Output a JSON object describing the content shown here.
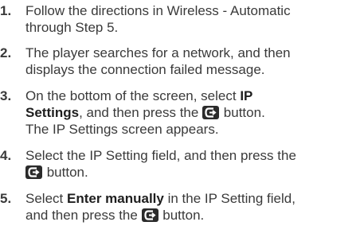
{
  "steps": [
    {
      "number": "1.",
      "lines": [
        "Follow the directions in Wireless - Automatic",
        "through Step 5."
      ]
    },
    {
      "number": "2.",
      "lines": [
        "The player searches for a network, and then",
        "displays the connection failed message."
      ]
    },
    {
      "number": "3.",
      "line1_pre": "On the bottom of the screen, select ",
      "line1_bold": "IP",
      "line2_bold": "Settings",
      "line2_post": ", and then press the",
      "line2_end": " button.",
      "line3": "The IP Settings screen appears."
    },
    {
      "number": "4.",
      "line1": "Select the IP Setting field, and then press the",
      "line2_post": " button."
    },
    {
      "number": "5.",
      "line1_pre": "Select ",
      "line1_bold": "Enter manually",
      "line1_post": " in the IP Setting field,",
      "line2_pre": "and then press the ",
      "line2_post": " button."
    }
  ],
  "icons": {
    "enter": "enter-button-icon",
    "enter_color": "#2b2b2b"
  }
}
